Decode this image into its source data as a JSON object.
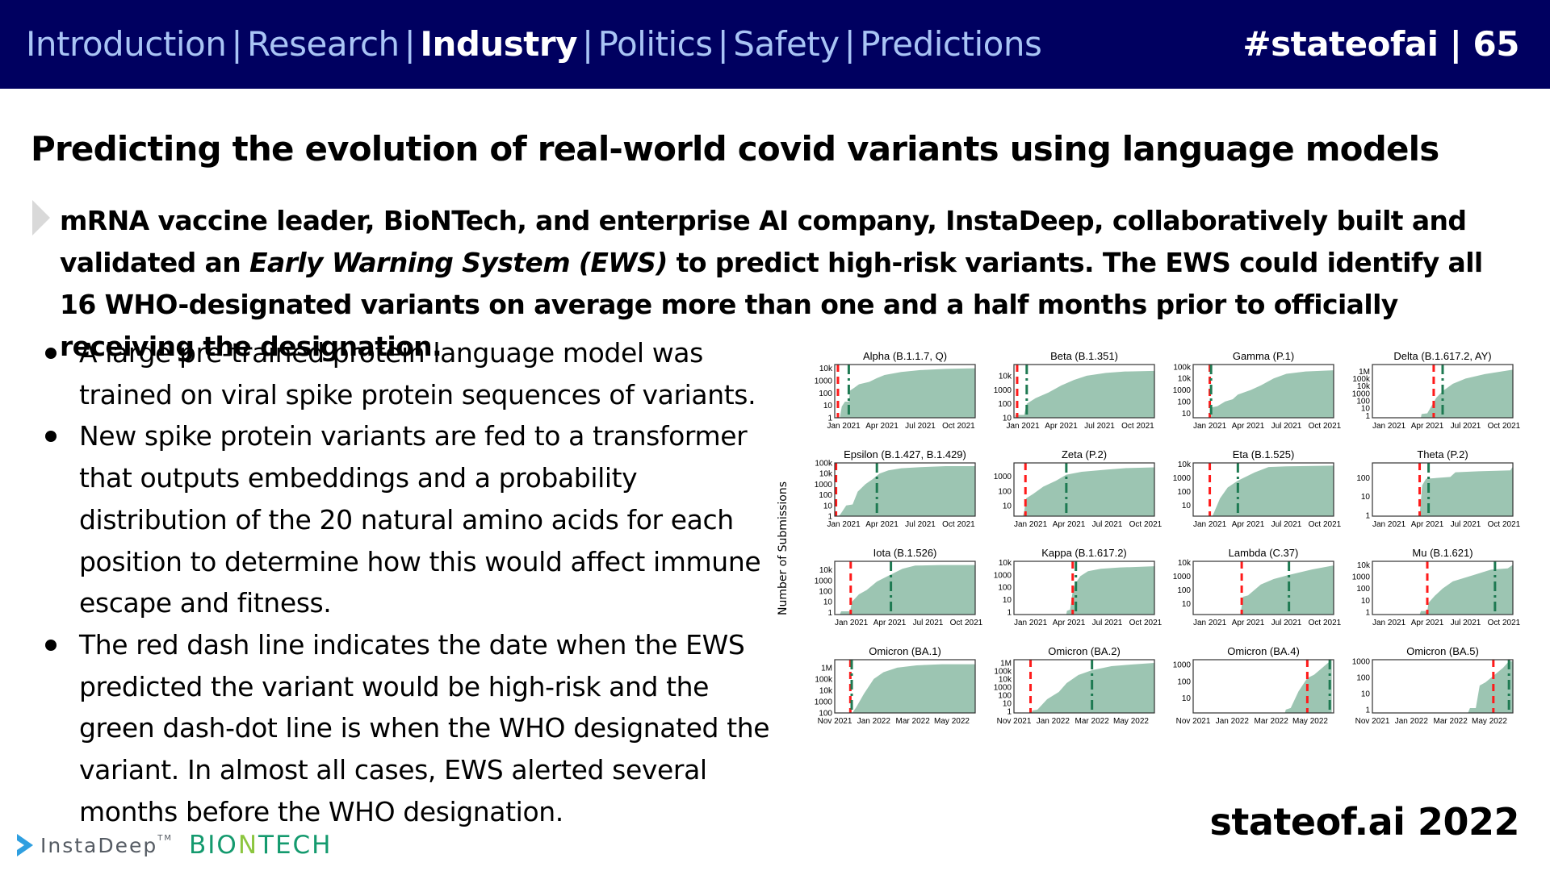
{
  "header": {
    "nav": [
      {
        "label": "Introduction",
        "active": false
      },
      {
        "label": "Research",
        "active": false
      },
      {
        "label": "Industry",
        "active": true
      },
      {
        "label": "Politics",
        "active": false
      },
      {
        "label": "Safety",
        "active": false
      },
      {
        "label": "Predictions",
        "active": false
      }
    ],
    "separator": "|",
    "tag": "#stateofai | 65"
  },
  "slide": {
    "title": "Predicting the evolution of real-world covid variants using language models",
    "lead": {
      "part1": "mRNA vaccine leader, BioNTech, and enterprise AI company, InstaDeep, collaboratively built and validated an ",
      "italic": "Early Warning System (EWS)",
      "part2": " to predict high-risk variants. The EWS could identify all 16 WHO-designated variants on average more than one and a half months prior to officially receiving the designation."
    },
    "bullets": [
      "A large pre-trained protein language model was trained on viral spike protein sequences of variants.",
      "New spike protein variants are fed to a transformer that outputs embeddings and a probability distribution of the 20 natural amino acids for each position to determine how this would affect immune escape and fitness.",
      "The red dash line indicates the date when the EWS predicted the variant would be high-risk and the green dash-dot line is when the WHO designated the variant. In almost all cases, EWS alerted several months before the WHO designation."
    ],
    "footer": "stateof.ai 2022",
    "logos": {
      "instadeep": "InstaDeep",
      "instadeep_tm": "TM",
      "biontech_parts": [
        {
          "text": "BIO",
          "color": "#149a6e"
        },
        {
          "text": "N",
          "color": "#8cc63f"
        },
        {
          "text": "TECH",
          "color": "#149a6e"
        }
      ]
    }
  },
  "colors": {
    "header_bg": "#000060",
    "nav_inactive": "#a9c4f5",
    "area_fill": "#9cc5b2",
    "ews_line": "#ff1a1a",
    "who_line": "#1e7a52"
  },
  "chart_data": {
    "type": "area",
    "ylabel": "Number of Submissions",
    "yscale": "log",
    "legend": {
      "ews_prediction": "red dashed line",
      "who_designation": "green dash-dot line"
    },
    "panels": [
      {
        "title": "Alpha (B.1.1.7, Q)",
        "xticks": [
          "Jan 2021",
          "Apr 2021",
          "Jul 2021",
          "Oct 2021"
        ],
        "xrange": [
          -0.7,
          10.3
        ],
        "yticks": [
          "1",
          "10",
          "100",
          "1000",
          "10k"
        ],
        "ylog": [
          0,
          4.3
        ],
        "ews": -0.45,
        "who": 0.4,
        "curve": [
          [
            -0.3,
            0
          ],
          [
            -0.15,
            0.9
          ],
          [
            0.1,
            1.3
          ],
          [
            0.4,
            1.3
          ],
          [
            0.5,
            2.2
          ],
          [
            0.8,
            2.4
          ],
          [
            1.2,
            2.7
          ],
          [
            2.0,
            2.9
          ],
          [
            2.6,
            3.2
          ],
          [
            3.2,
            3.45
          ],
          [
            4.5,
            3.7
          ],
          [
            6,
            3.85
          ],
          [
            8,
            3.95
          ],
          [
            10.3,
            4.0
          ]
        ]
      },
      {
        "title": "Beta (B.1.351)",
        "xticks": [
          "Jan 2021",
          "Apr 2021",
          "Jul 2021",
          "Oct 2021"
        ],
        "xrange": [
          -0.7,
          10.3
        ],
        "yticks": [
          "10",
          "100",
          "1000",
          "10k"
        ],
        "ylog": [
          1,
          4.8
        ],
        "ews": -0.45,
        "who": 0.3,
        "curve": [
          [
            -0.6,
            1.2
          ],
          [
            0.1,
            1.2
          ],
          [
            0.3,
            2.0
          ],
          [
            1,
            2.4
          ],
          [
            2,
            2.8
          ],
          [
            3,
            3.3
          ],
          [
            4,
            3.7
          ],
          [
            5,
            4.0
          ],
          [
            6.5,
            4.2
          ],
          [
            8,
            4.3
          ],
          [
            10.3,
            4.35
          ]
        ]
      },
      {
        "title": "Gamma (P.1)",
        "xticks": [
          "Jan 2021",
          "Apr 2021",
          "Jul 2021",
          "Oct 2021"
        ],
        "xrange": [
          -1.3,
          9.7
        ],
        "yticks": [
          "10",
          "100",
          "1000",
          "10k",
          "100k"
        ],
        "ylog": [
          0.6,
          5.2
        ],
        "ews": 0.0,
        "who": 0.1,
        "curve": [
          [
            0.1,
            0.6
          ],
          [
            0.15,
            1.5
          ],
          [
            0.6,
            1.6
          ],
          [
            1.2,
            2.0
          ],
          [
            1.8,
            2.2
          ],
          [
            2.2,
            2.6
          ],
          [
            3.2,
            3.0
          ],
          [
            4,
            3.4
          ],
          [
            5,
            4.0
          ],
          [
            6,
            4.4
          ],
          [
            7.5,
            4.6
          ],
          [
            9.7,
            4.7
          ]
        ]
      },
      {
        "title": "Delta (B.1.617.2, AY)",
        "xticks": [
          "Jan 2021",
          "Apr 2021",
          "Jul 2021",
          "Oct 2021"
        ],
        "xrange": [
          -1.3,
          9.7
        ],
        "yticks": [
          "1",
          "10",
          "100",
          "1000",
          "10k",
          "100k",
          "1M"
        ],
        "ylog": [
          -0.3,
          6.9
        ],
        "ews": 3.5,
        "who": 4.2,
        "curve": [
          [
            2.5,
            -0.3
          ],
          [
            2.55,
            0.2
          ],
          [
            3.0,
            0.3
          ],
          [
            3.3,
            1.2
          ],
          [
            3.7,
            2.4
          ],
          [
            4.2,
            3.3
          ],
          [
            5,
            4.3
          ],
          [
            6,
            5.0
          ],
          [
            7.5,
            5.6
          ],
          [
            9.7,
            6.2
          ]
        ]
      },
      {
        "title": "Epsilon (B.1.427, B.1.429)",
        "xticks": [
          "Jan 2021",
          "Apr 2021",
          "Jul 2021",
          "Oct 2021"
        ],
        "xrange": [
          -0.7,
          10.3
        ],
        "yticks": [
          "1",
          "10",
          "100",
          "1000",
          "10k",
          "100k"
        ],
        "ylog": [
          0,
          5.0
        ],
        "ews": -0.6,
        "who": 2.6,
        "curve": [
          [
            -0.5,
            0
          ],
          [
            -0.3,
            0.1
          ],
          [
            0.2,
            1.0
          ],
          [
            0.7,
            1.1
          ],
          [
            1.1,
            2.3
          ],
          [
            1.7,
            3.0
          ],
          [
            2.3,
            3.5
          ],
          [
            2.8,
            4.0
          ],
          [
            3.5,
            4.3
          ],
          [
            4.5,
            4.5
          ],
          [
            6,
            4.6
          ],
          [
            8,
            4.7
          ],
          [
            10.3,
            4.7
          ]
        ]
      },
      {
        "title": "Zeta (P.2)",
        "xticks": [
          "Jan 2021",
          "Apr 2021",
          "Jul 2021",
          "Oct 2021"
        ],
        "xrange": [
          -1.3,
          9.7
        ],
        "yticks": [
          "10",
          "100",
          "1000"
        ],
        "ylog": [
          0.3,
          3.9
        ],
        "ews": -0.4,
        "who": 2.8,
        "curve": [
          [
            -0.6,
            0.3
          ],
          [
            -0.5,
            0.6
          ],
          [
            -0.35,
            1.5
          ],
          [
            0.2,
            1.8
          ],
          [
            1,
            2.3
          ],
          [
            2,
            2.7
          ],
          [
            2.8,
            3.1
          ],
          [
            4,
            3.3
          ],
          [
            6,
            3.45
          ],
          [
            7.5,
            3.55
          ],
          [
            9.7,
            3.6
          ]
        ]
      },
      {
        "title": "Eta (B.1.525)",
        "xticks": [
          "Jan 2021",
          "Apr 2021",
          "Jul 2021",
          "Oct 2021"
        ],
        "xrange": [
          -1.3,
          9.7
        ],
        "yticks": [
          "10",
          "100",
          "1000",
          "10k"
        ],
        "ylog": [
          0.2,
          4.1
        ],
        "ews": 0.0,
        "who": 2.2,
        "curve": [
          [
            0.2,
            0.2
          ],
          [
            0.35,
            0.5
          ],
          [
            0.8,
            1.5
          ],
          [
            1.4,
            2.3
          ],
          [
            2.2,
            2.8
          ],
          [
            3.5,
            3.4
          ],
          [
            4.6,
            3.8
          ],
          [
            6,
            3.85
          ],
          [
            9.7,
            3.9
          ]
        ]
      },
      {
        "title": "Theta (P.2)",
        "xticks": [
          "Jan 2021",
          "Apr 2021",
          "Jul 2021",
          "Oct 2021"
        ],
        "xrange": [
          -1.3,
          9.7
        ],
        "yticks": [
          "1",
          "10",
          "100"
        ],
        "ylog": [
          -0.05,
          2.8
        ],
        "ews": 2.4,
        "who": 3.1,
        "curve": [
          [
            2.4,
            0
          ],
          [
            2.6,
            1.6
          ],
          [
            2.9,
            1.95
          ],
          [
            4.8,
            2.05
          ],
          [
            5.2,
            2.3
          ],
          [
            7,
            2.35
          ],
          [
            9.5,
            2.4
          ],
          [
            9.7,
            2.6
          ]
        ]
      },
      {
        "title": "Iota (B.1.526)",
        "xticks": [
          "Jan 2021",
          "Apr 2021",
          "Jul 2021",
          "Oct 2021"
        ],
        "xrange": [
          -1.3,
          9.7
        ],
        "yticks": [
          "1",
          "10",
          "100",
          "1000",
          "10k"
        ],
        "ylog": [
          -0.2,
          4.8
        ],
        "ews": -0.05,
        "who": 3.1,
        "curve": [
          [
            -0.9,
            -0.2
          ],
          [
            -0.8,
            0.1
          ],
          [
            -0.1,
            0.1
          ],
          [
            0.05,
            1.0
          ],
          [
            0.6,
            1.7
          ],
          [
            1.2,
            2.1
          ],
          [
            2,
            2.9
          ],
          [
            3,
            3.5
          ],
          [
            4,
            4.1
          ],
          [
            5,
            4.4
          ],
          [
            7,
            4.45
          ],
          [
            9.7,
            4.45
          ]
        ]
      },
      {
        "title": "Kappa (B.1.617.2)",
        "xticks": [
          "Jan 2021",
          "Apr 2021",
          "Jul 2021",
          "Oct 2021"
        ],
        "xrange": [
          -1.3,
          9.7
        ],
        "yticks": [
          "1",
          "10",
          "100",
          "1000",
          "10k"
        ],
        "ylog": [
          -0.2,
          4.1
        ],
        "ews": 3.3,
        "who": 3.55,
        "curve": [
          [
            2.8,
            -0.2
          ],
          [
            2.85,
            0.1
          ],
          [
            3.1,
            0.2
          ],
          [
            3.3,
            1.7
          ],
          [
            3.5,
            2.3
          ],
          [
            3.9,
            2.9
          ],
          [
            4.5,
            3.3
          ],
          [
            5.5,
            3.5
          ],
          [
            7,
            3.6
          ],
          [
            9.7,
            3.7
          ]
        ]
      },
      {
        "title": "Lambda (C.37)",
        "xticks": [
          "Jan 2021",
          "Apr 2021",
          "Jul 2021",
          "Oct 2021"
        ],
        "xrange": [
          -1.3,
          9.7
        ],
        "yticks": [
          "10",
          "100",
          "1000",
          "10k"
        ],
        "ylog": [
          0.2,
          4.1
        ],
        "ews": 2.5,
        "who": 6.2,
        "curve": [
          [
            2.4,
            0.2
          ],
          [
            2.6,
            1.5
          ],
          [
            3,
            1.6
          ],
          [
            4,
            2.4
          ],
          [
            5,
            2.8
          ],
          [
            6.2,
            3.1
          ],
          [
            8,
            3.5
          ],
          [
            9.7,
            3.8
          ]
        ]
      },
      {
        "title": "Mu (B.1.621)",
        "xticks": [
          "Jan 2021",
          "Apr 2021",
          "Jul 2021",
          "Oct 2021"
        ],
        "xrange": [
          -1.3,
          9.7
        ],
        "yticks": [
          "1",
          "10",
          "100",
          "1000",
          "10k"
        ],
        "ylog": [
          -0.2,
          4.3
        ],
        "ews": 3.0,
        "who": 8.3,
        "curve": [
          [
            2.4,
            -0.2
          ],
          [
            2.5,
            0.1
          ],
          [
            3,
            0.1
          ],
          [
            3.1,
            0.8
          ],
          [
            3.6,
            1.4
          ],
          [
            4.2,
            2.0
          ],
          [
            5,
            2.6
          ],
          [
            6.5,
            3.1
          ],
          [
            8,
            3.6
          ],
          [
            9.3,
            3.7
          ],
          [
            9.7,
            4.0
          ]
        ]
      },
      {
        "title": "Omicron (BA.1)",
        "xticks": [
          "Nov 2021",
          "Jan 2022",
          "Mar 2022",
          "May 2022"
        ],
        "xrange": [
          0,
          7.2
        ],
        "yticks": [
          "100",
          "1000",
          "10k",
          "100k",
          "1M"
        ],
        "ylog": [
          2,
          6.7
        ],
        "ews": 0.8,
        "who": 0.87,
        "curve": [
          [
            0.9,
            2
          ],
          [
            1.1,
            2.5
          ],
          [
            1.5,
            3.7
          ],
          [
            2,
            5.0
          ],
          [
            2.5,
            5.6
          ],
          [
            3.2,
            6.0
          ],
          [
            4.2,
            6.2
          ],
          [
            5.5,
            6.3
          ],
          [
            7.2,
            6.3
          ]
        ]
      },
      {
        "title": "Omicron (BA.2)",
        "xticks": [
          "Nov 2021",
          "Jan 2022",
          "Mar 2022",
          "May 2022"
        ],
        "xrange": [
          0,
          7.2
        ],
        "yticks": [
          "1",
          "10",
          "100",
          "1000",
          "10k",
          "100k",
          "1M"
        ],
        "ylog": [
          -0.2,
          6.4
        ],
        "ews": 0.85,
        "who": 4.0,
        "curve": [
          [
            0.9,
            -0.2
          ],
          [
            0.95,
            0.1
          ],
          [
            1.2,
            0.2
          ],
          [
            1.7,
            1.5
          ],
          [
            2.3,
            2.4
          ],
          [
            2.7,
            3.5
          ],
          [
            3.3,
            4.5
          ],
          [
            4,
            5.1
          ],
          [
            5,
            5.6
          ],
          [
            6,
            5.8
          ],
          [
            7.2,
            6.0
          ]
        ]
      },
      {
        "title": "Omicron (BA.4)",
        "xticks": [
          "Nov 2021",
          "Jan 2022",
          "Mar 2022",
          "May 2022"
        ],
        "xrange": [
          0,
          7.2
        ],
        "yticks": [
          "10",
          "100",
          "1000"
        ],
        "ylog": [
          0.1,
          3.3
        ],
        "ews": 5.85,
        "who": 7.0,
        "curve": [
          [
            4.7,
            0.1
          ],
          [
            4.75,
            0.3
          ],
          [
            5.0,
            0.4
          ],
          [
            5.4,
            1.4
          ],
          [
            5.85,
            2.2
          ],
          [
            6.2,
            2.4
          ],
          [
            6.6,
            2.8
          ],
          [
            7.0,
            3.2
          ],
          [
            7.1,
            3.3
          ]
        ]
      },
      {
        "title": "Omicron (BA.5)",
        "xticks": [
          "Nov 2021",
          "Jan 2022",
          "Mar 2022",
          "May 2022"
        ],
        "xrange": [
          0,
          7.2
        ],
        "yticks": [
          "1",
          "10",
          "100",
          "1000"
        ],
        "ylog": [
          -0.2,
          3.1
        ],
        "ews": 6.2,
        "who": 7.0,
        "curve": [
          [
            4.9,
            -0.2
          ],
          [
            5.0,
            0.1
          ],
          [
            5.3,
            0.1
          ],
          [
            5.5,
            1.5
          ],
          [
            5.8,
            1.7
          ],
          [
            6.2,
            2.1
          ],
          [
            6.7,
            2.6
          ],
          [
            7.0,
            3.0
          ],
          [
            7.2,
            3.0
          ]
        ]
      }
    ]
  }
}
